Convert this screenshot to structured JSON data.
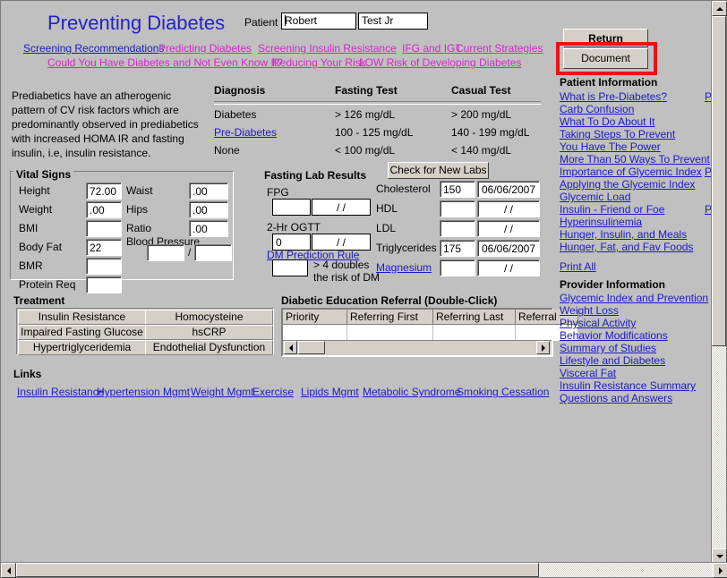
{
  "header": {
    "title": "Preventing Diabetes",
    "patient_label": "Patient",
    "patient_first": "Robert",
    "patient_last": "Test Jr",
    "return_label": "Return",
    "document_label": "Document",
    "highlight_color": "#ee1111",
    "title_color": "#2222cc"
  },
  "nav": {
    "row1": [
      {
        "label": "Screening Recommendations",
        "color": "blue"
      },
      {
        "label": "Predicting Diabetes",
        "color": "pink"
      },
      {
        "label": "Screening Insulin Resistance",
        "color": "pink"
      },
      {
        "label": "IFG and IGT",
        "color": "pink"
      },
      {
        "label": "Current Strategies",
        "color": "pink"
      }
    ],
    "row2": [
      {
        "label": "Could You Have Diabetes and Not Even Know It?",
        "color": "pink"
      },
      {
        "label": "Reducing Your Risk",
        "color": "pink"
      },
      {
        "label": "LOW Risk of Developing Diabetes",
        "color": "pink"
      }
    ]
  },
  "intro_paragraph": "Prediabetics  have an atherogenic pattern of CV risk factors which are predominantly observed in prediabetics with increased HOMA IR and fasting insulin, i.e, insulin resistance.",
  "diagnosis_table": {
    "headers": [
      "Diagnosis",
      "Fasting Test",
      "Casual Test"
    ],
    "rows": [
      {
        "diagnosis": "Diabetes",
        "is_link": false,
        "fasting": "> 126 mg/dL",
        "casual": "> 200 mg/dL"
      },
      {
        "diagnosis": "Pre-Diabetes",
        "is_link": true,
        "fasting": "100 - 125 mg/dL",
        "casual": "140 - 199 mg/dL"
      },
      {
        "diagnosis": "None",
        "is_link": false,
        "fasting": "< 100 mg/dL",
        "casual": "< 140 mg/dL"
      }
    ]
  },
  "vital_signs": {
    "title": "Vital Signs",
    "left": [
      {
        "label": "Height",
        "value": "72.00"
      },
      {
        "label": "Weight",
        "value": ".00"
      },
      {
        "label": "BMI",
        "value": ""
      },
      {
        "label": "Body Fat",
        "value": "22"
      },
      {
        "label": "BMR",
        "value": ""
      },
      {
        "label": "Protein Req",
        "value": ""
      }
    ],
    "right": [
      {
        "label": "Waist",
        "value": ".00"
      },
      {
        "label": "Hips",
        "value": ".00"
      },
      {
        "label": "Ratio",
        "value": ".00"
      }
    ],
    "blood_pressure_label": "Blood Pressure",
    "bp_systolic": "",
    "bp_diastolic": "",
    "bp_separator": "/"
  },
  "fasting_labs": {
    "title": "Fasting Lab Results",
    "check_labs_label": "Check for New Labs",
    "left_fields": [
      {
        "label": "FPG",
        "value": "",
        "date": "/ /"
      },
      {
        "label": "2-Hr OGTT",
        "value": "0",
        "date": "/ /"
      }
    ],
    "prediction_rule_link": "DM Prediction Rule",
    "prediction_value": "",
    "prediction_note_line1": "> 4 doubles",
    "prediction_note_line2": "the risk of DM",
    "right_fields": [
      {
        "label": "Cholesterol",
        "is_link": false,
        "value": "150",
        "date": "06/06/2007"
      },
      {
        "label": "HDL",
        "is_link": false,
        "value": "",
        "date": "/ /"
      },
      {
        "label": "LDL",
        "is_link": false,
        "value": "",
        "date": "/ /"
      },
      {
        "label": "Triglycerides",
        "is_link": false,
        "value": "175",
        "date": "06/06/2007"
      },
      {
        "label": "Magnesium",
        "is_link": true,
        "value": "",
        "date": "/ /"
      }
    ]
  },
  "treatment": {
    "title": "Treatment",
    "buttons": [
      "Insulin Resistance",
      "Homocysteine",
      "Impaired Fasting Glucose",
      "hsCRP",
      "Hypertriglyceridemia",
      "Endothelial Dysfunction"
    ]
  },
  "referral": {
    "title": "Diabetic Education Referral (Double-Click)",
    "columns": [
      "Priority",
      "Referring First",
      "Referring Last",
      "Referral"
    ],
    "rows": [
      [
        "",
        "",
        "",
        ""
      ]
    ]
  },
  "links_section": {
    "title": "Links",
    "items": [
      "Insulin Resistance",
      "Hypertension Mgmt",
      "Weight Mgmt",
      "Exercise",
      "Lipids Mgmt",
      "Metabolic Syndrome",
      "Smoking Cessation"
    ]
  },
  "patient_information": {
    "title": "Patient Information",
    "items": [
      "What is Pre-Diabetes?",
      "Carb Confusion",
      "What To Do About It",
      "Taking Steps To Prevent",
      "You Have The Power",
      "More Than 50 Ways To Prevent",
      "Importance of Glycemic Index",
      "Applying the Glycemic Index",
      "Glycemic Load",
      "Insulin - Friend or Foe",
      "Hyperinsulinemia",
      "Hunger, Insulin, and Meals",
      "Hunger, Fat, and Fav Foods"
    ],
    "print_all": "Print All",
    "clipped_links": [
      "Pr",
      "Pr",
      "Pr"
    ]
  },
  "provider_information": {
    "title": "Provider Information",
    "items": [
      "Glycemic Index and Prevention",
      "Weight Loss",
      "Physical Activity",
      "Behavior Modifications",
      "Summary of Studies",
      "Lifestyle and Diabetes",
      "Visceral Fat",
      "Insulin Resistance Summary",
      "Questions and Answers"
    ]
  }
}
